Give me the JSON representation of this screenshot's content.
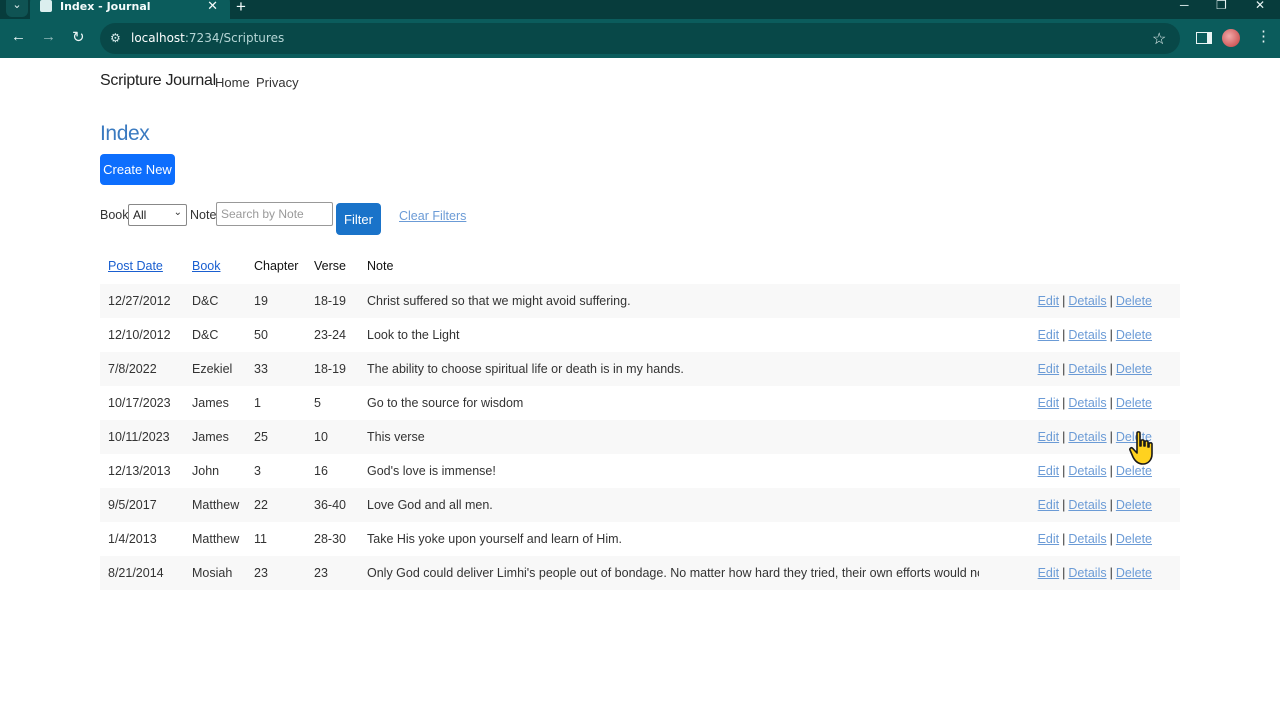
{
  "browser": {
    "tab_title": "Index - Journal",
    "tab_close": "✕",
    "new_tab": "+",
    "url_host": "localhost",
    "url_path": ":7234/Scriptures"
  },
  "nav": {
    "brand": "Scripture Journal",
    "links": [
      "Home",
      "Privacy"
    ]
  },
  "main": {
    "heading": "Index",
    "create_new": "Create New"
  },
  "filters": {
    "book_label": "Book:",
    "book_selected": "All",
    "note_label": "Note:",
    "note_placeholder": "Search by Note",
    "filter_button": "Filter",
    "clear_link": "Clear Filters"
  },
  "table": {
    "headers": {
      "post_date": "Post Date",
      "book": "Book",
      "chapter": "Chapter",
      "verse": "Verse",
      "note": "Note"
    },
    "action_labels": {
      "edit": "Edit",
      "details": "Details",
      "delete": "Delete",
      "separator": "|"
    },
    "rows": [
      {
        "date": "12/27/2012",
        "book": "D&C",
        "chapter": "19",
        "verse": "18-19",
        "note": "Christ suffered so that we might avoid suffering."
      },
      {
        "date": "12/10/2012",
        "book": "D&C",
        "chapter": "50",
        "verse": "23-24",
        "note": "Look to the Light"
      },
      {
        "date": "7/8/2022",
        "book": "Ezekiel",
        "chapter": "33",
        "verse": "18-19",
        "note": "The ability to choose spiritual life or death is in my hands."
      },
      {
        "date": "10/17/2023",
        "book": "James",
        "chapter": "1",
        "verse": "5",
        "note": "Go to the source for wisdom"
      },
      {
        "date": "10/11/2023",
        "book": "James",
        "chapter": "25",
        "verse": "10",
        "note": "This verse"
      },
      {
        "date": "12/13/2013",
        "book": "John",
        "chapter": "3",
        "verse": "16",
        "note": "God's love is immense!"
      },
      {
        "date": "9/5/2017",
        "book": "Matthew",
        "chapter": "22",
        "verse": "36-40",
        "note": "Love God and all men."
      },
      {
        "date": "1/4/2013",
        "book": "Matthew",
        "chapter": "11",
        "verse": "28-30",
        "note": "Take His yoke upon yourself and learn of Him."
      },
      {
        "date": "8/21/2014",
        "book": "Mosiah",
        "chapter": "23",
        "verse": "23",
        "note": "Only God could deliver Limhi's people out of bondage. No matter how hard they tried, their own efforts would not deliver them."
      }
    ]
  },
  "colors": {
    "chrome_dark": "#073c3c",
    "chrome_toolbar": "#0b5c5c",
    "primary_button": "#0d6efd",
    "link": "#6b9bd6",
    "heading": "#3a7ac0"
  },
  "icons": [
    "tab-menu-icon",
    "back-arrow-icon",
    "forward-arrow-icon",
    "reload-icon",
    "site-settings-icon",
    "star-icon",
    "side-panel-icon",
    "profile-avatar",
    "more-menu-icon",
    "hand-cursor-icon"
  ]
}
